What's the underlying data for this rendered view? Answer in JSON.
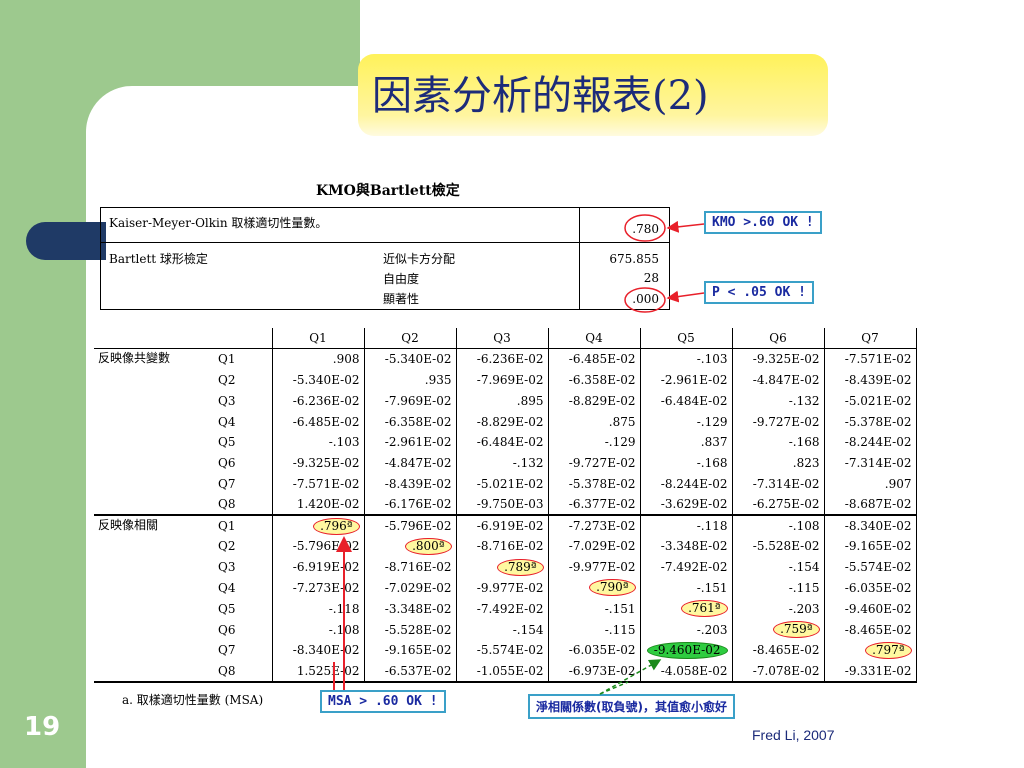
{
  "slide": {
    "title": "因素分析的報表(2)",
    "number": "19",
    "author": "Fred Li, 2007"
  },
  "kmo": {
    "heading": "KMO與Bartlett檢定",
    "kmo_label": "Kaiser-Meyer-Olkin 取樣適切性量數。",
    "kmo_value": ".780",
    "bartlett_label": "Bartlett 球形檢定",
    "chi_label": "近似卡方分配",
    "chi_value": "675.855",
    "df_label": "自由度",
    "df_value": "28",
    "sig_label": "顯著性",
    "sig_value": ".000"
  },
  "callouts": {
    "kmo": "KMO >.60 OK !",
    "p": "P < .05 OK !",
    "msa": "MSA > .60 OK !",
    "partial": "淨相關係數(取負號)，其值愈小愈好"
  },
  "matrix": {
    "columns": [
      "Q1",
      "Q2",
      "Q3",
      "Q4",
      "Q5",
      "Q6",
      "Q7"
    ],
    "section_covariance": "反映像共變數",
    "section_correlation": "反映像相關",
    "row_labels": [
      "Q1",
      "Q2",
      "Q3",
      "Q4",
      "Q5",
      "Q6",
      "Q7",
      "Q8"
    ],
    "covariance": [
      [
        ".908",
        "-5.340E-02",
        "-6.236E-02",
        "-6.485E-02",
        "-.103",
        "-9.325E-02",
        "-7.571E-02"
      ],
      [
        "-5.340E-02",
        ".935",
        "-7.969E-02",
        "-6.358E-02",
        "-2.961E-02",
        "-4.847E-02",
        "-8.439E-02"
      ],
      [
        "-6.236E-02",
        "-7.969E-02",
        ".895",
        "-8.829E-02",
        "-6.484E-02",
        "-.132",
        "-5.021E-02"
      ],
      [
        "-6.485E-02",
        "-6.358E-02",
        "-8.829E-02",
        ".875",
        "-.129",
        "-9.727E-02",
        "-5.378E-02"
      ],
      [
        "-.103",
        "-2.961E-02",
        "-6.484E-02",
        "-.129",
        ".837",
        "-.168",
        "-8.244E-02"
      ],
      [
        "-9.325E-02",
        "-4.847E-02",
        "-.132",
        "-9.727E-02",
        "-.168",
        ".823",
        "-7.314E-02"
      ],
      [
        "-7.571E-02",
        "-8.439E-02",
        "-5.021E-02",
        "-5.378E-02",
        "-8.244E-02",
        "-7.314E-02",
        ".907"
      ],
      [
        "1.420E-02",
        "-6.176E-02",
        "-9.750E-03",
        "-6.377E-02",
        "-3.629E-02",
        "-6.275E-02",
        "-8.687E-02"
      ]
    ],
    "correlation": [
      [
        ".796ª",
        "-5.796E-02",
        "-6.919E-02",
        "-7.273E-02",
        "-.118",
        "-.108",
        "-8.340E-02"
      ],
      [
        "-5.796E-02",
        ".800ª",
        "-8.716E-02",
        "-7.029E-02",
        "-3.348E-02",
        "-5.528E-02",
        "-9.165E-02"
      ],
      [
        "-6.919E-02",
        "-8.716E-02",
        ".789ª",
        "-9.977E-02",
        "-7.492E-02",
        "-.154",
        "-5.574E-02"
      ],
      [
        "-7.273E-02",
        "-7.029E-02",
        "-9.977E-02",
        ".790ª",
        "-.151",
        "-.115",
        "-6.035E-02"
      ],
      [
        "-.118",
        "-3.348E-02",
        "-7.492E-02",
        "-.151",
        ".761ª",
        "-.203",
        "-9.460E-02"
      ],
      [
        "-.108",
        "-5.528E-02",
        "-.154",
        "-.115",
        "-.203",
        ".759ª",
        "-8.465E-02"
      ],
      [
        "-8.340E-02",
        "-9.165E-02",
        "-5.574E-02",
        "-6.035E-02",
        "-9.460E-02",
        "-8.465E-02",
        ".797ª"
      ],
      [
        "1.525E-02",
        "-6.537E-02",
        "-1.055E-02",
        "-6.973E-02",
        "-4.058E-02",
        "-7.078E-02",
        "-9.331E-02"
      ]
    ],
    "footnote": "a. 取樣適切性量數 (MSA)"
  }
}
